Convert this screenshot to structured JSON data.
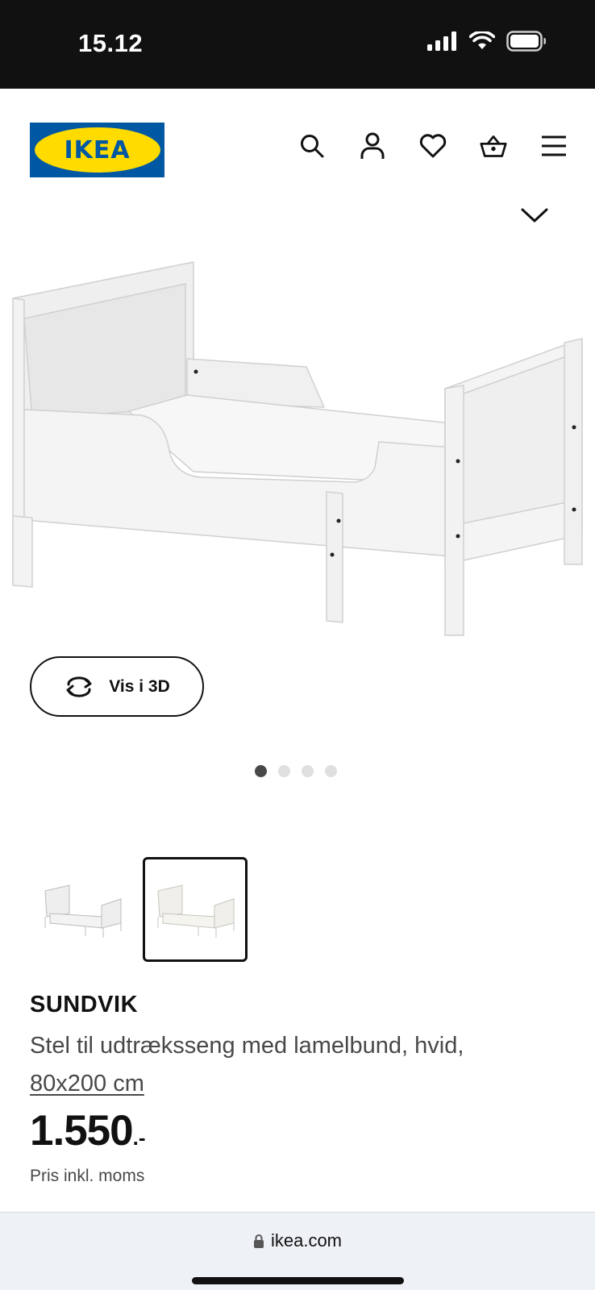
{
  "status_bar": {
    "time": "15.12",
    "icons": [
      "signal-icon",
      "wifi-icon",
      "battery-icon"
    ]
  },
  "header": {
    "logo_text": "IKEA",
    "brand_colors": {
      "blue": "#0058A3",
      "yellow": "#FFDB00"
    },
    "nav_icons": [
      "search-icon",
      "account-icon",
      "favorites-icon",
      "basket-icon",
      "menu-icon"
    ]
  },
  "gallery": {
    "view_3d_label": "Vis i 3D",
    "dots_total": 4,
    "active_dot": 1,
    "thumbnails": 2,
    "selected_thumbnail": 2
  },
  "product": {
    "name": "SUNDVIK",
    "description": "Stel til udtræksseng med lamelbund, hvid,",
    "size": "80x200 cm",
    "price": "1.550",
    "price_suffix": ".-",
    "price_note": "Pris inkl. moms"
  },
  "browser": {
    "url": "ikea.com"
  }
}
